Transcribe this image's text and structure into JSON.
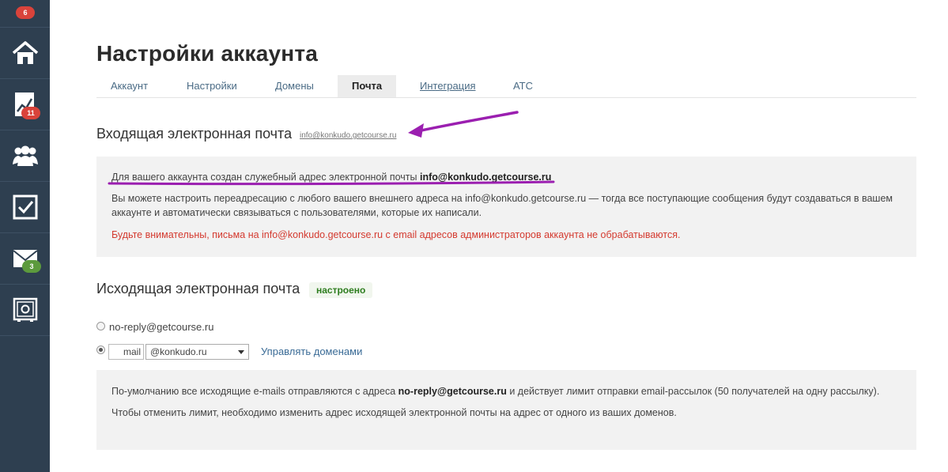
{
  "sidebar": {
    "top_badge": "6",
    "items": [
      {
        "icon": "home-icon"
      },
      {
        "icon": "chart-icon",
        "badge": "11",
        "badge_color": "#d9433b"
      },
      {
        "icon": "users-icon"
      },
      {
        "icon": "tasks-checkbox-icon"
      },
      {
        "icon": "mail-icon",
        "badge": "3",
        "badge_color": "#5c9a3d"
      },
      {
        "icon": "safe-icon"
      }
    ]
  },
  "header": {
    "title": "Настройки аккаунта"
  },
  "tabs": [
    {
      "label": "Аккаунт"
    },
    {
      "label": "Настройки"
    },
    {
      "label": "Домены"
    },
    {
      "label": "Почта",
      "active": true
    },
    {
      "label": "Интеграция"
    },
    {
      "label": "АТС"
    }
  ],
  "incoming": {
    "title": "Входящая электронная почта",
    "address_link": "info@konkudo.getcourse.ru",
    "notice_prefix": "Для вашего аккаунта создан служебный адрес электронной почты",
    "notice_address": "info@konkudo.getcourse.ru",
    "info": "Вы можете настроить переадресацию с любого вашего внешнего адреса на info@konkudo.getcourse.ru — тогда все поступающие сообщения будут создаваться в вашем аккаунте и автоматически связываться с пользователями, которые их написали.",
    "warning": "Будьте внимательны, письма на info@konkudo.getcourse.ru с email адресов администраторов аккаунта не обрабатываются."
  },
  "outgoing": {
    "title": "Исходящая электронная почта",
    "status": "настроено",
    "option_default": "no-reply@getcourse.ru",
    "mailbox_value": "mail",
    "domain_selected": "@konkudo.ru",
    "manage_domains_link": "Управлять доменами",
    "info_prefix": "По-умолчанию все исходящие e-mails отправляются с адреса",
    "info_address": "no-reply@getcourse.ru",
    "info_suffix": "и действует лимит отправки email-рассылок (50 получателей на одну рассылку).",
    "info_limit": "Чтобы отменить лимит, необходимо изменить адрес исходящей электронной почты на адрес от одного из ваших доменов."
  },
  "colors": {
    "sidebar": "#2e3f50",
    "annotation_purple": "#9b1fb0",
    "warning_red": "#d43a2f",
    "status_green": "#2e7d1f"
  }
}
